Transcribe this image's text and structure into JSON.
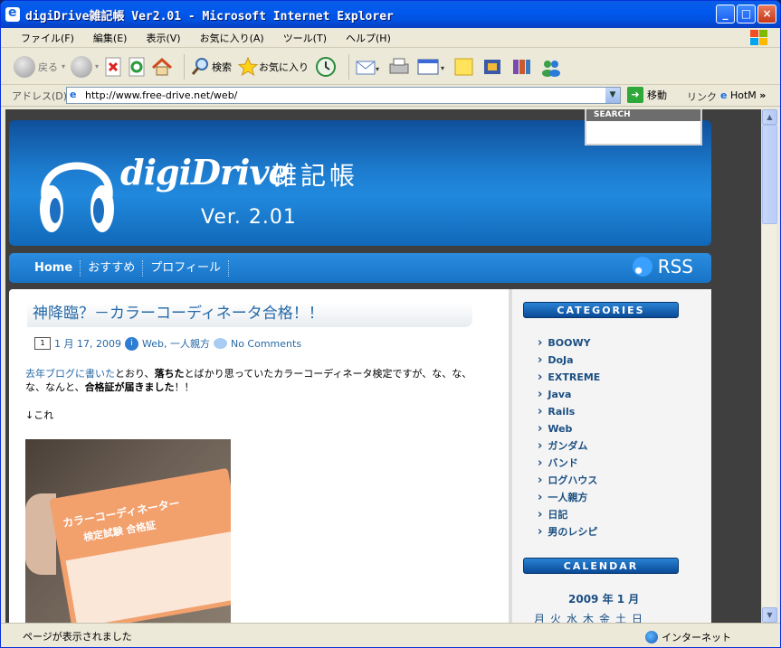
{
  "window": {
    "title": "digiDrive雑記帳  Ver2.01 - Microsoft Internet Explorer",
    "minimize": "_",
    "maximize": "□",
    "close": "×"
  },
  "menu": [
    "ファイル(F)",
    "編集(E)",
    "表示(V)",
    "お気に入り(A)",
    "ツール(T)",
    "ヘルプ(H)"
  ],
  "toolbar": {
    "back": "戻る",
    "search": "検索",
    "favorites": "お気に入り"
  },
  "address": {
    "label": "アドレス(D)",
    "url": "http://www.free-drive.net/web/",
    "go": "移動",
    "links": "リンク",
    "hotmail": "HotM"
  },
  "site": {
    "logo": "digiDrive",
    "logo_sub": "雑記帳",
    "version": "Ver. 2.01",
    "search_label": "SEARCH",
    "nav": [
      "Home",
      "おすすめ",
      "プロフィール"
    ],
    "rss": "RSS"
  },
  "post": {
    "title": "神降臨？－カラーコーディネータ合格！！",
    "date": "1 月 17, 2009",
    "category_links": "Web, 一人親方",
    "comments": "No Comments",
    "link_text": "去年ブログに書いた",
    "body_a": "とおり、",
    "body_b": "落ちた",
    "body_c": "とばかり思っていたカラーコーディネータ検定ですが、な、な、な、なんと、",
    "body_d": "合格証が届きました",
    "body_e": "！！",
    "arrow": "↓これ",
    "card_line1": "カラーコーディネーター",
    "card_line2": "検定試験 合格証"
  },
  "sidebar": {
    "categories_title": "CATEGORIES",
    "categories": [
      "BOOWY",
      "DoJa",
      "EXTREME",
      "Java",
      "Rails",
      "Web",
      "ガンダム",
      "バンド",
      "ログハウス",
      "一人親方",
      "日記",
      "男のレシピ"
    ],
    "calendar_title": "CALENDAR",
    "calendar_month": "2009 年 1 月",
    "calendar_weekdays": "月火水木金土日"
  },
  "status": {
    "text": "ページが表示されました",
    "zone": "インターネット"
  }
}
